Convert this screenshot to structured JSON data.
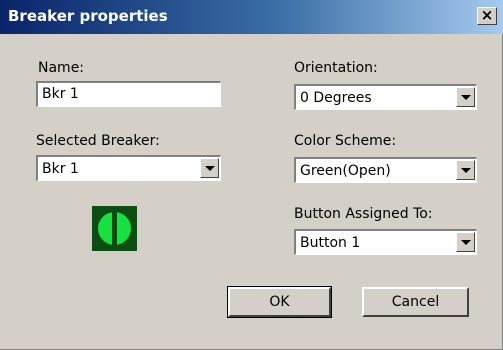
{
  "window": {
    "title": "Breaker properties",
    "close_label": "×"
  },
  "fields": {
    "name": {
      "label": "Name:",
      "value": "Bkr 1"
    },
    "selected_breaker": {
      "label": "Selected Breaker:",
      "value": "Bkr 1"
    },
    "orientation": {
      "label": "Orientation:",
      "value": "0 Degrees"
    },
    "color_scheme": {
      "label": "Color Scheme:",
      "value": "Green(Open)"
    },
    "button_assigned": {
      "label": "Button Assigned To:",
      "value": "Button 1"
    }
  },
  "buttons": {
    "ok": "OK",
    "cancel": "Cancel"
  },
  "colors": {
    "breaker_green": "#18e040",
    "breaker_bg": "#0b4d12"
  },
  "icons": {
    "breaker_preview": "breaker-open-icon"
  }
}
